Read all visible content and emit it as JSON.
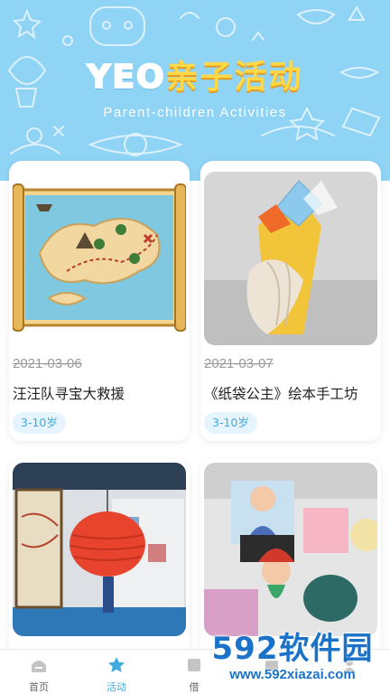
{
  "header": {
    "title_latin": "YEO",
    "title_chinese": "亲子活动",
    "subtitle": "Parent-children Activities"
  },
  "activities": [
    {
      "date": "2021-03-06",
      "name": "汪汪队寻宝大救援",
      "age_tag": "3-10岁",
      "image": "treasure-map-illustration"
    },
    {
      "date": "2021-03-07",
      "name": "《纸袋公主》绘本手工坊",
      "age_tag": "3-10岁",
      "image": "paper-crown-craft-photo"
    },
    {
      "date": "",
      "name": "",
      "age_tag": "",
      "image": "paper-lanterns-photo"
    },
    {
      "date": "",
      "name": "",
      "age_tag": "",
      "image": "dolls-toys-photo"
    }
  ],
  "tabbar": {
    "items": [
      {
        "label": "首页",
        "icon": "home-icon",
        "active": false
      },
      {
        "label": "活动",
        "icon": "star-icon",
        "active": true
      },
      {
        "label": "借",
        "icon": "book-icon",
        "active": false
      },
      {
        "label": "",
        "icon": "cart-icon",
        "active": false
      },
      {
        "label": "",
        "icon": "user-icon",
        "active": false
      }
    ]
  },
  "watermark": {
    "logo": "592软件园",
    "url": "www.592xiazai.com"
  },
  "colors": {
    "banner_bg": "#8fd3f5",
    "title_accent": "#ffd84a",
    "tab_active": "#3fa9e0",
    "tag_bg": "#e6f5fd"
  }
}
